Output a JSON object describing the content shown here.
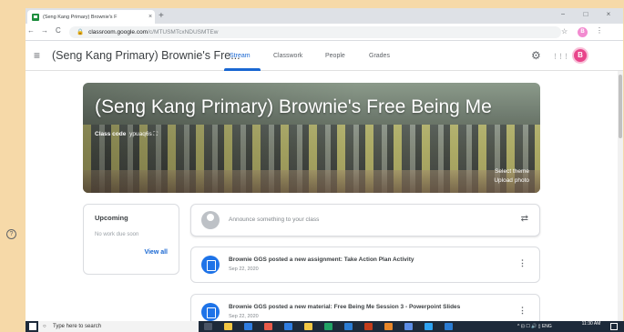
{
  "browser": {
    "tab_title": "(Seng Kang Primary) Brownie's F",
    "tab_close": "×",
    "new_tab": "+",
    "window_controls": [
      "−",
      "□",
      "×"
    ],
    "nav": {
      "back": "←",
      "forward": "→",
      "reload": "C"
    },
    "url_host": "classroom.google.com",
    "url_path": "/c/MTUSMTcxNDUSMTEw",
    "lock": "🔒",
    "star": "☆",
    "profile_initial": "B",
    "menu": "⋮"
  },
  "header": {
    "menu_icon": "≡",
    "class_title": "(Seng Kang Primary) Brownie's Fre...",
    "tabs": [
      {
        "label": "Stream",
        "active": true
      },
      {
        "label": "Classwork",
        "active": false
      },
      {
        "label": "People",
        "active": false
      },
      {
        "label": "Grades",
        "active": false
      }
    ],
    "settings_icon": "⚙",
    "apps_icon": "⋮⋮⋮",
    "avatar_initial": "B",
    "avatar_color": "#e8458b"
  },
  "banner": {
    "title": "(Seng Kang Primary) Brownie's Free Being Me",
    "class_code_label": "Class code",
    "class_code_value": "ypuaq6s ⛶",
    "select_theme": "Select theme",
    "upload_photo": "Upload photo"
  },
  "upcoming": {
    "title": "Upcoming",
    "empty": "No work due soon",
    "view_all": "View all"
  },
  "announce": {
    "placeholder": "Announce something to your class",
    "repost_icon": "⇄"
  },
  "posts": [
    {
      "title": "Brownie GGS posted a new assignment: Take Action Plan Activity",
      "date": "Sep 22, 2020",
      "menu": "⋮"
    },
    {
      "title": "Brownie GGS posted a new material: Free Being Me Session 3 - Powerpoint Slides",
      "date": "Sep 22, 2020",
      "menu": "⋮"
    }
  ],
  "help": "?",
  "taskbar": {
    "search_placeholder": "Type here to search",
    "tray": "^ ⊡ ☐ 🔊 ▯ ENG",
    "time": "11:30 AM",
    "app_colors": [
      "#4a5566",
      "#f2c744",
      "#2f7de1",
      "#e85b4a",
      "#2f7de1",
      "#f2c744",
      "#21a366",
      "#2b7cd3",
      "#c43e1c",
      "#e8872a",
      "#5c8ee6",
      "#2ea3f2",
      "#2b7cd3"
    ]
  },
  "colors": {
    "accent": "#1967d2",
    "frame": "#f6d9a8"
  }
}
